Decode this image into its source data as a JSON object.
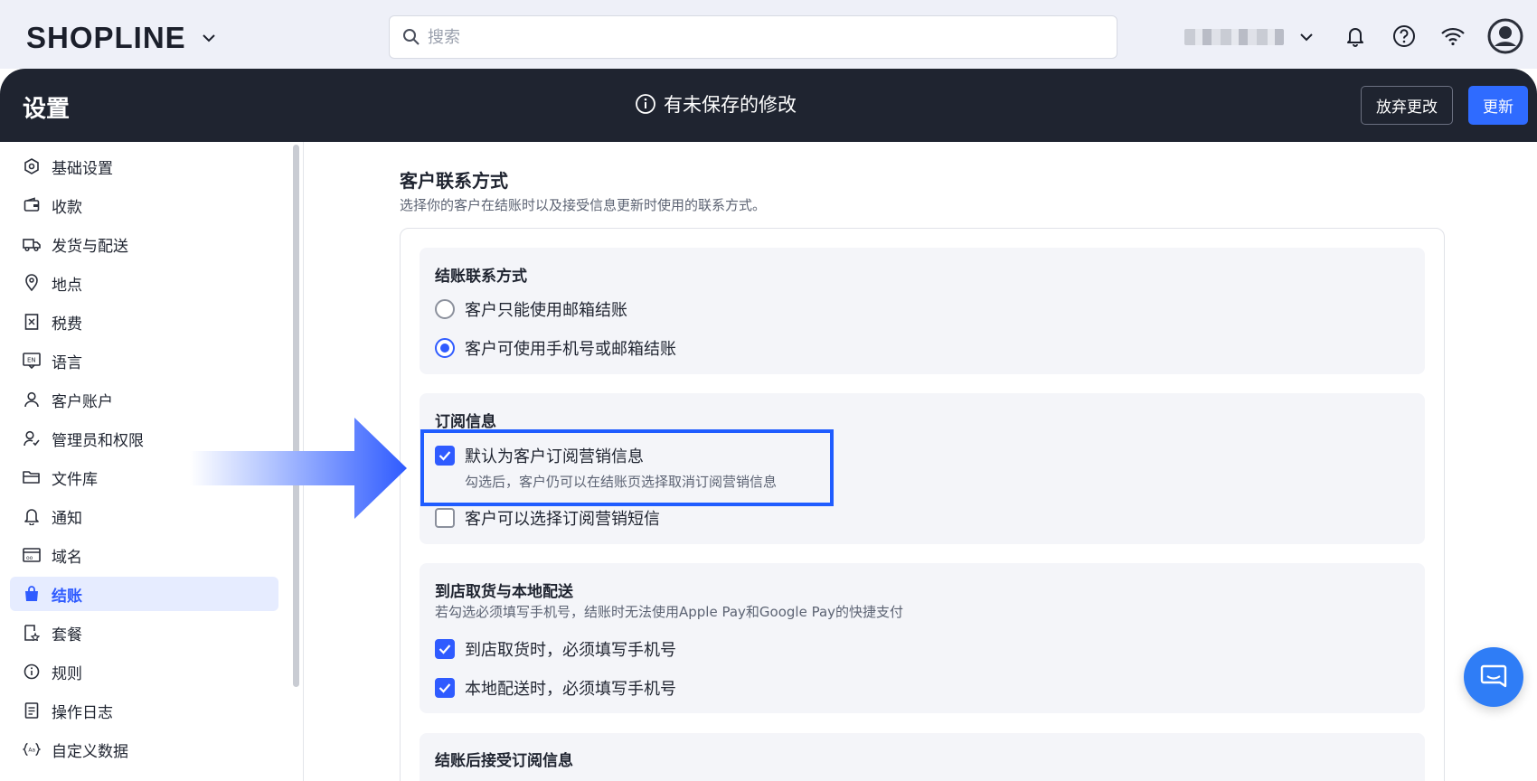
{
  "topbar": {
    "logo_text": "SHOPLINE",
    "search_placeholder": "搜索",
    "icons": [
      "chevron-down-icon",
      "search-icon",
      "bell-icon",
      "help-icon",
      "wifi-icon",
      "user-avatar-icon"
    ]
  },
  "header": {
    "title": "设置",
    "unsaved_text": "有未保存的修改",
    "discard_label": "放弃更改",
    "update_label": "更新"
  },
  "sidebar": {
    "items": [
      {
        "label": "基础设置",
        "icon": "settings-icon"
      },
      {
        "label": "收款",
        "icon": "wallet-icon"
      },
      {
        "label": "发货与配送",
        "icon": "truck-icon"
      },
      {
        "label": "地点",
        "icon": "location-icon"
      },
      {
        "label": "税费",
        "icon": "tax-icon"
      },
      {
        "label": "语言",
        "icon": "language-icon"
      },
      {
        "label": "客户账户",
        "icon": "user-icon"
      },
      {
        "label": "管理员和权限",
        "icon": "admin-icon"
      },
      {
        "label": "文件库",
        "icon": "folder-icon"
      },
      {
        "label": "通知",
        "icon": "bell-icon"
      },
      {
        "label": "域名",
        "icon": "domain-icon"
      },
      {
        "label": "结账",
        "icon": "bag-icon",
        "active": true
      },
      {
        "label": "套餐",
        "icon": "plan-icon"
      },
      {
        "label": "规则",
        "icon": "info-icon"
      },
      {
        "label": "操作日志",
        "icon": "log-icon"
      },
      {
        "label": "自定义数据",
        "icon": "code-icon"
      }
    ]
  },
  "main": {
    "section_title": "客户联系方式",
    "section_subtitle": "选择你的客户在结账时以及接受信息更新时使用的联系方式。",
    "checkout_contact": {
      "title": "结账联系方式",
      "options": [
        {
          "label": "客户只能使用邮箱结账",
          "selected": false
        },
        {
          "label": "客户可使用手机号或邮箱结账",
          "selected": true
        }
      ]
    },
    "subscription": {
      "title": "订阅信息",
      "default_subscribe": {
        "label": "默认为客户订阅营销信息",
        "checked": true,
        "hint": "勾选后，客户仍可以在结账页选择取消订阅营销信息"
      },
      "sms_subscribe": {
        "label": "客户可以选择订阅营销短信",
        "checked": false
      }
    },
    "pickup_delivery": {
      "title": "到店取货与本地配送",
      "subtitle": "若勾选必须填写手机号，结账时无法使用Apple Pay和Google Pay的快捷支付",
      "options": [
        {
          "label": "到店取货时，必须填写手机号",
          "checked": true
        },
        {
          "label": "本地配送时，必须填写手机号",
          "checked": true
        }
      ]
    },
    "post_checkout": {
      "title": "结账后接受订阅信息"
    }
  },
  "colors": {
    "accent": "#2f5bff",
    "dark_header": "#1f2430",
    "highlight_border": "#1f5cff"
  }
}
